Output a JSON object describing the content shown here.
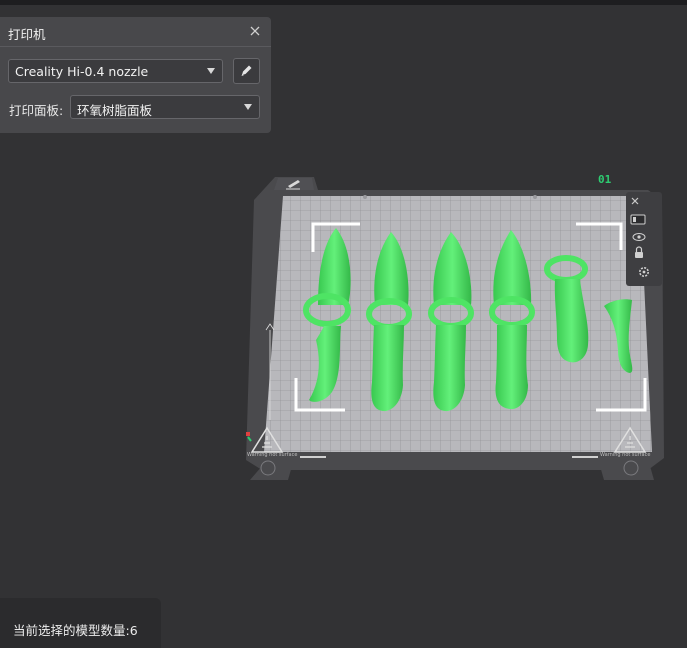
{
  "printer_panel": {
    "title": "打印机",
    "nozzle_select": "Creality Hi-0.4 nozzle",
    "plate_label": "打印面板:",
    "plate_select": "环氧树脂面板"
  },
  "viewport": {
    "plate_number": "01",
    "plate_warning_left": "Warning hot surface",
    "plate_warning_right": "Warning hot surface",
    "model_color": "#4ee464"
  },
  "status": {
    "selection_text": "当前选择的模型数量:6"
  },
  "icons": [
    "close-icon",
    "pencil-icon",
    "plate-edit-icon",
    "plate-list-icon",
    "plate-view-icon",
    "plate-lock-icon",
    "plate-settings-icon"
  ]
}
